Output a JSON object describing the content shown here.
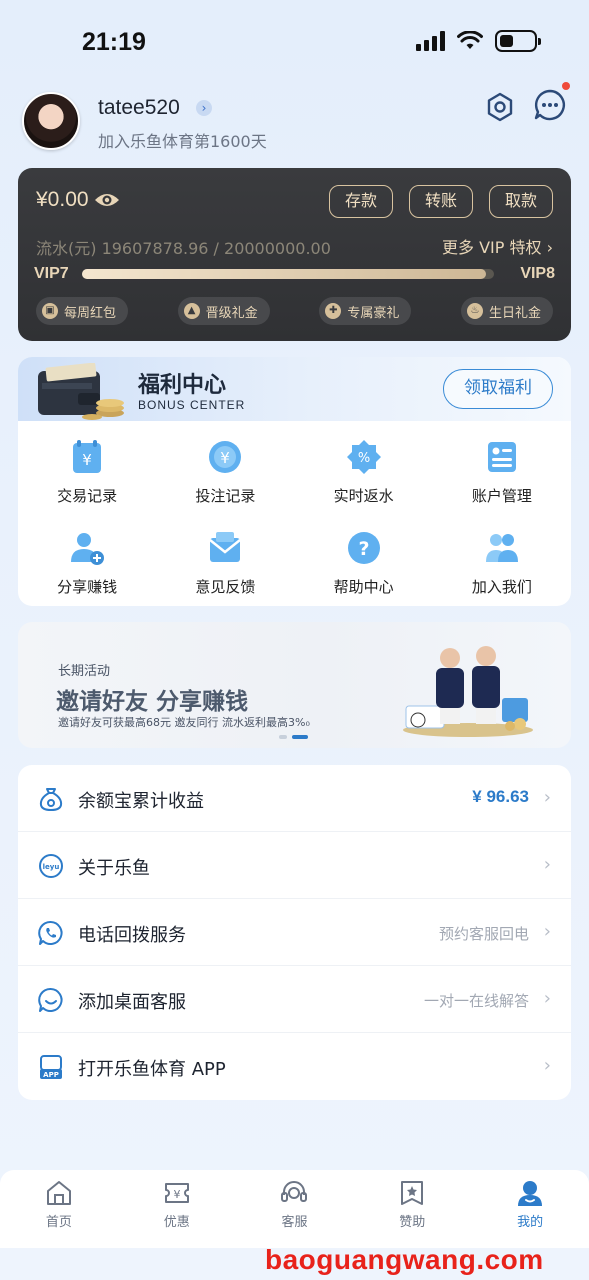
{
  "status_bar": {
    "time": "21:19"
  },
  "profile": {
    "username": "tatee520",
    "join_text": "加入乐鱼体育第1600天"
  },
  "wallet": {
    "balance": "¥0.00",
    "buttons": [
      "存款",
      "转账",
      "取款"
    ],
    "flow_text": "流水(元) 19607878.96 / 20000000.00",
    "more_vip": "更多 VIP 特权 ›",
    "vip_current": "VIP7",
    "vip_next": "VIP8",
    "vip_progress": 0.98,
    "perks": [
      "每周红包",
      "晋级礼金",
      "专属豪礼",
      "生日礼金"
    ]
  },
  "bonus_center": {
    "title": "福利中心",
    "subtitle": "BONUS CENTER",
    "claim_button": "领取福利",
    "items": [
      {
        "label": "交易记录",
        "icon": "transaction-icon"
      },
      {
        "label": "投注记录",
        "icon": "bet-record-icon"
      },
      {
        "label": "实时返水",
        "icon": "rebate-icon"
      },
      {
        "label": "账户管理",
        "icon": "account-icon"
      },
      {
        "label": "分享赚钱",
        "icon": "share-icon"
      },
      {
        "label": "意见反馈",
        "icon": "feedback-icon"
      },
      {
        "label": "帮助中心",
        "icon": "help-icon"
      },
      {
        "label": "加入我们",
        "icon": "join-icon"
      }
    ]
  },
  "banner": {
    "tag": "长期活动",
    "title": "邀请好友 分享赚钱",
    "description": "邀请好友可获最高68元 邀友同行 流水返利最高3%₀"
  },
  "list": [
    {
      "label": "余额宝累计收益",
      "value": "¥ 96.63",
      "icon": "moneybag-icon"
    },
    {
      "label": "关于乐鱼",
      "value": "",
      "icon": "leyu-logo-icon"
    },
    {
      "label": "电话回拨服务",
      "value": "预约客服回电",
      "icon": "phone-icon"
    },
    {
      "label": "添加桌面客服",
      "value": "一对一在线解答",
      "icon": "chat-icon"
    },
    {
      "label": "打开乐鱼体育 APP",
      "value": "",
      "icon": "app-icon"
    }
  ],
  "tabs": [
    {
      "label": "首页",
      "icon": "home-icon"
    },
    {
      "label": "优惠",
      "icon": "coupon-icon"
    },
    {
      "label": "客服",
      "icon": "headset-icon"
    },
    {
      "label": "赞助",
      "icon": "sponsor-icon"
    },
    {
      "label": "我的",
      "icon": "profile-icon",
      "active": true
    }
  ],
  "watermark": "baoguangwang.com",
  "colors": {
    "accent": "#2c7bc9",
    "gold": "#e8d6b8",
    "card_dark": "#36373a"
  }
}
